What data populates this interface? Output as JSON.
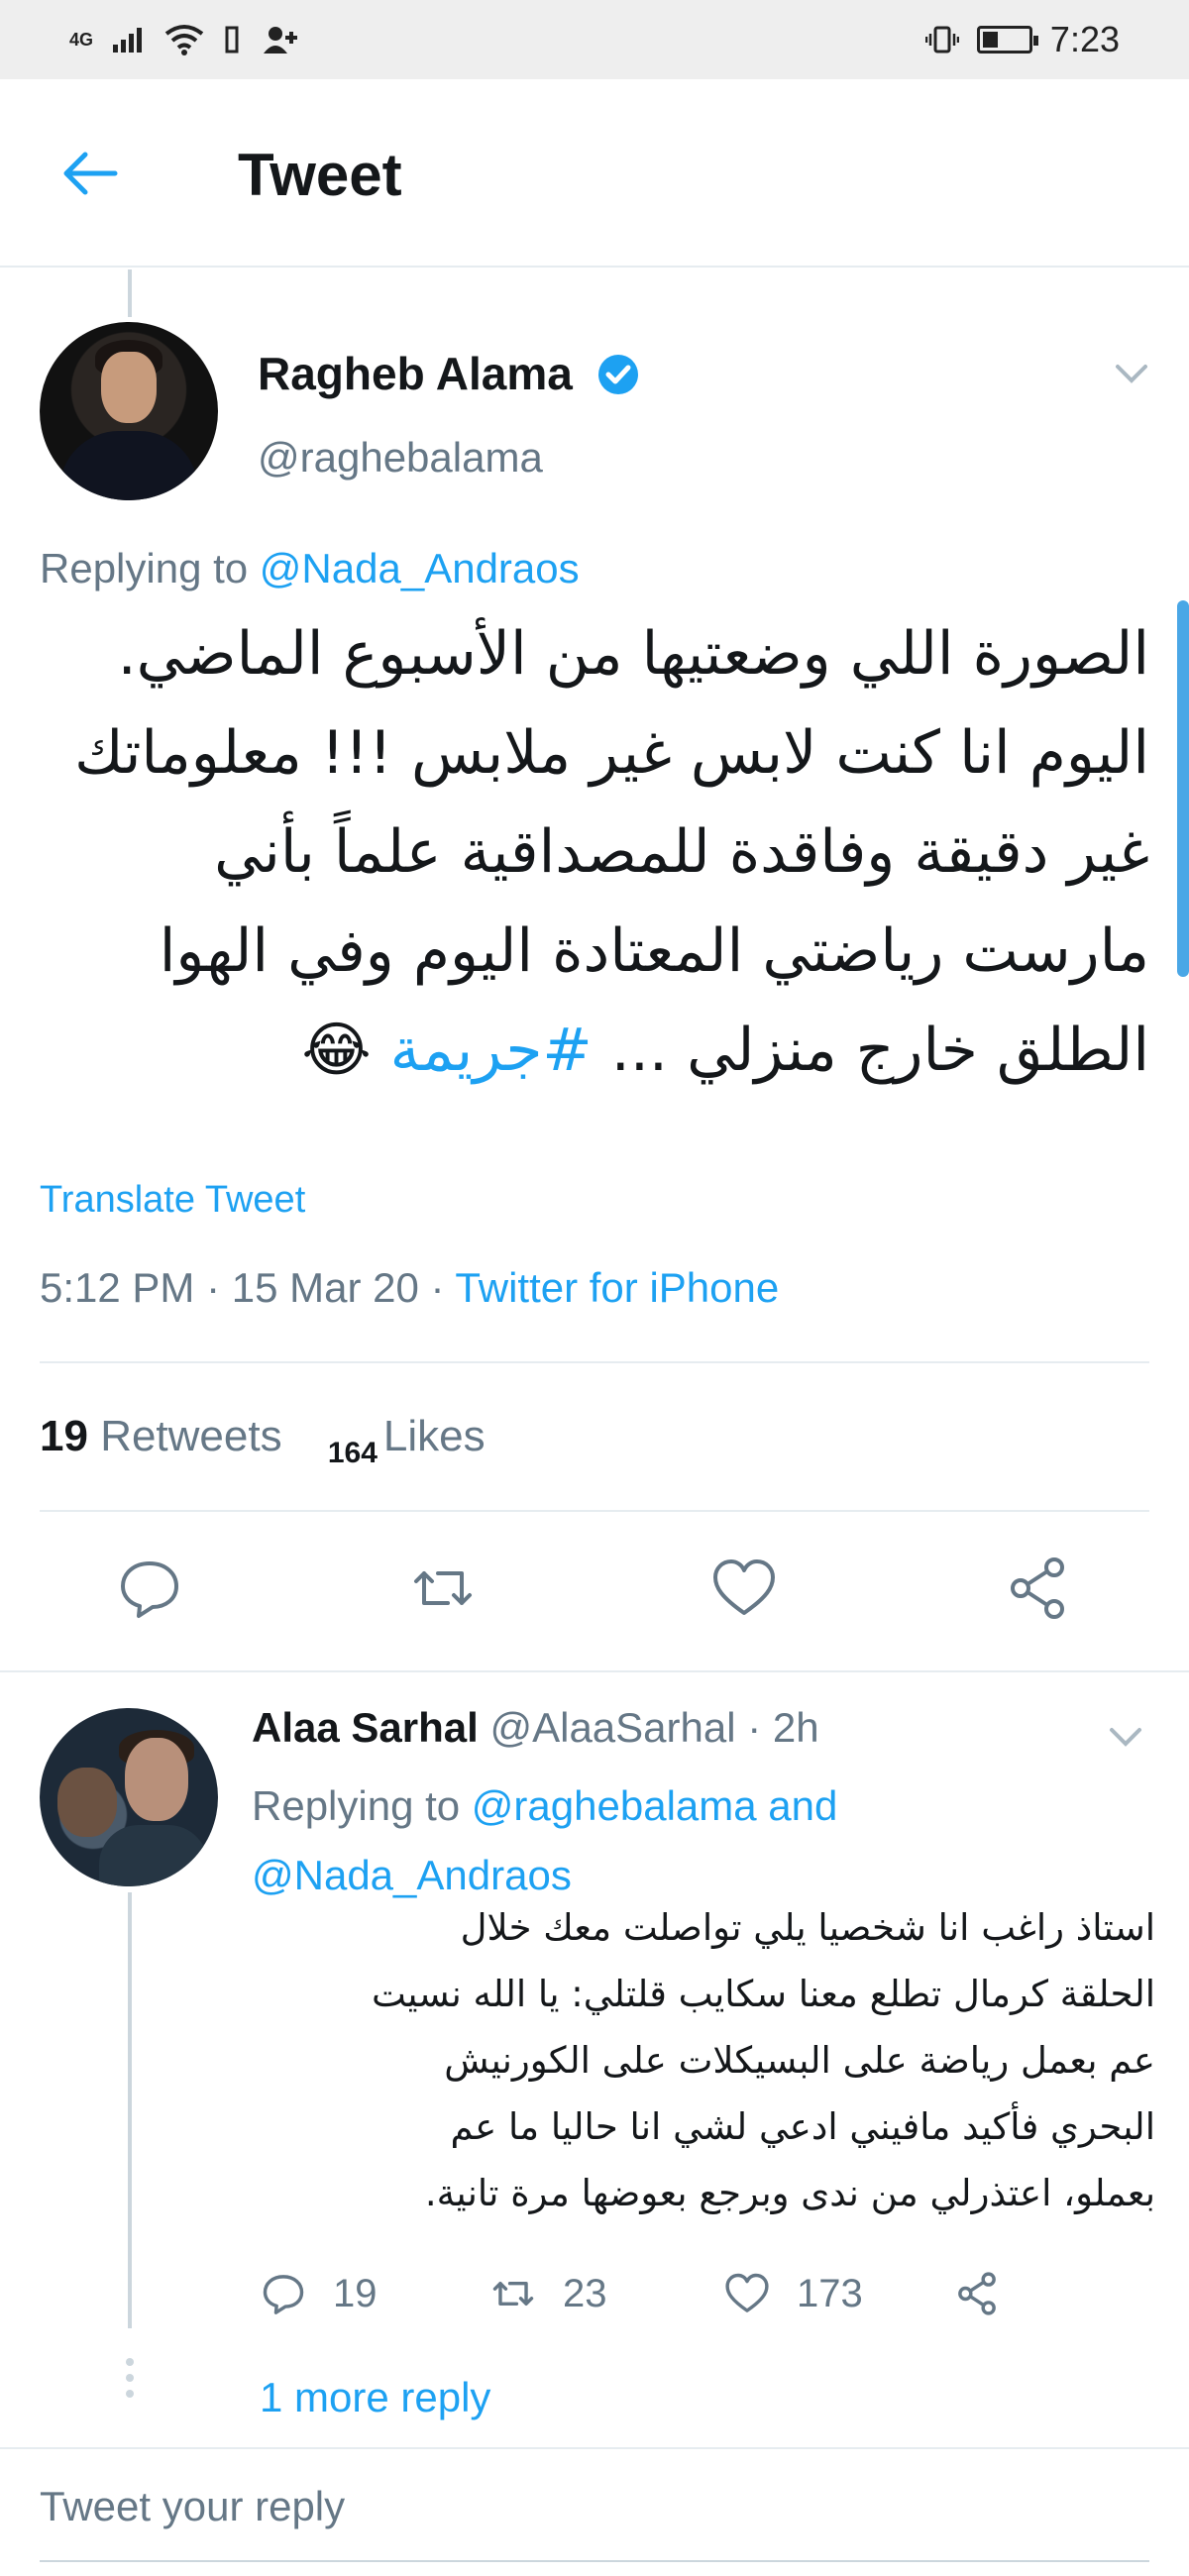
{
  "status_bar": {
    "network": "4G",
    "time": "7:23"
  },
  "header": {
    "title": "Tweet"
  },
  "tweet": {
    "author_name": "Ragheb Alama",
    "author_handle": "@raghebalama",
    "replying_prefix": "Replying to ",
    "replying_to": "@Nada_Andraos",
    "body_lines": [
      "الصورة اللي وضعتيها من الأسبوع الماضي.",
      "اليوم انا كنت لابس غير ملابس !!! معلوماتك",
      "غير دقيقة وفاقدة للمصداقية علماً بأني",
      "مارست رياضتي المعتادة اليوم وفي الهوا"
    ],
    "body_last_line_text": "الطلق خارج منزلي ... ",
    "hashtag": "#جريمة",
    "emoji": "😂",
    "translate_label": "Translate Tweet",
    "timestamp": "5:12 PM · 15 Mar 20 · ",
    "source": "Twitter for iPhone",
    "retweets_count": "19",
    "retweets_label": "Retweets",
    "likes_count": "164",
    "likes_label": "Likes"
  },
  "reply": {
    "author_name": "Alaa Sarhal",
    "author_handle": "@AlaaSarhal · 2h",
    "replying_prefix": "Replying to ",
    "replying_to_1": "@raghebalama",
    "replying_and": " and",
    "replying_to_2": "@Nada_Andraos",
    "body_lines": [
      "استاذ راغب انا شخصيا يلي تواصلت معك خلال",
      "الحلقة كرمال تطلع معنا سكايب قلتلي: يا الله نسيت",
      "عم بعمل رياضة على البسيكلات على الكورنيش",
      "البحري فأكيد مافيني ادعي لشي انا حاليا ما عم",
      "بعملو، اعتذرلي من ندى وبرجع بعوضها مرة تانية."
    ],
    "reply_count": "19",
    "retweet_count": "23",
    "like_count": "173",
    "more_replies": "1 more reply"
  },
  "composer": {
    "placeholder": "Tweet your reply"
  },
  "colors": {
    "accent": "#1da1f2",
    "secondary_text": "#657786",
    "divider": "#e6ecf0"
  },
  "icons": [
    "signal-icon",
    "wifi-icon",
    "battery-icon",
    "back-arrow-icon",
    "verified-icon",
    "chevron-down-icon",
    "reply-icon",
    "retweet-icon",
    "like-icon",
    "share-icon"
  ]
}
